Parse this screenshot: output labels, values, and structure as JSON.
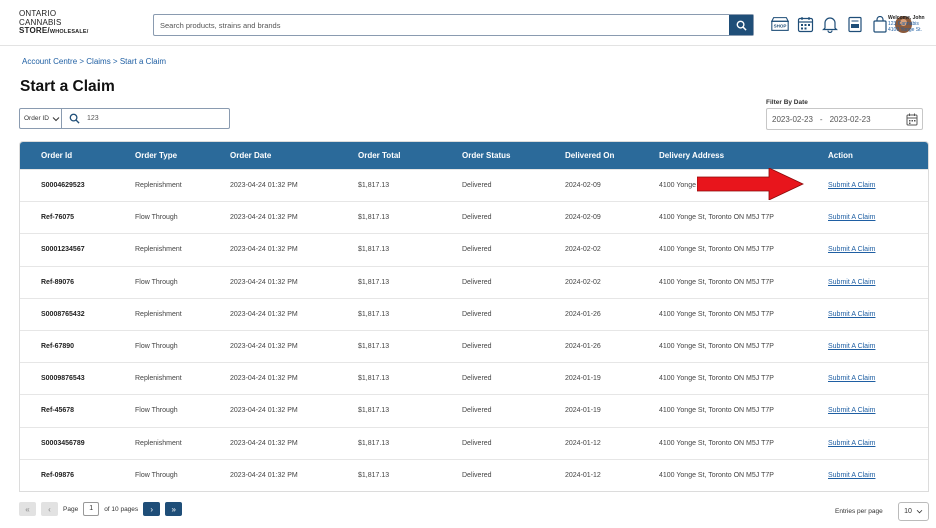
{
  "header": {
    "logo_line1": "ONTARIO",
    "logo_line2": "CANNABIS",
    "logo_line3": "STORE/",
    "logo_line3_small": "WHOLESALE/",
    "search_placeholder": "Search products, strains and brands",
    "welcome": "Welcome, John",
    "store_name": "123 Cannabis",
    "store_address": "4100 Yonge St.",
    "icons": [
      "shop-icon",
      "calendar-icon",
      "bell-icon",
      "invoice-icon",
      "shopping-bag-icon",
      "avatar"
    ]
  },
  "breadcrumb": "Account Centre > Claims > Start a Claim",
  "page_title": "Start a Claim",
  "filter": {
    "type_label": "Order ID",
    "value": "123",
    "date_label": "Filter By Date",
    "date_from": "2023-02-23",
    "date_to": "2023-02-23",
    "date_separator": "-"
  },
  "table": {
    "columns": [
      "Order Id",
      "Order Type",
      "Order Date",
      "Order Total",
      "Order Status",
      "Delivered On",
      "Delivery Address",
      "Action"
    ],
    "rows": [
      {
        "id": "S0004629523",
        "type": "Replenishment",
        "date": "2023-04-24 01:32 PM",
        "total": "$1,817.13",
        "status": "Delivered",
        "delivered": "2024-02-09",
        "address": "4100 Yonge",
        "action": "Submit A Claim"
      },
      {
        "id": "Ref-76075",
        "type": "Flow Through",
        "date": "2023-04-24 01:32 PM",
        "total": "$1,817.13",
        "status": "Delivered",
        "delivered": "2024-02-09",
        "address": "4100 Yonge St, Toronto ON M5J T7P",
        "action": "Submit A Claim"
      },
      {
        "id": "S0001234567",
        "type": "Replenishment",
        "date": "2023-04-24 01:32 PM",
        "total": "$1,817.13",
        "status": "Delivered",
        "delivered": "2024-02-02",
        "address": "4100 Yonge St, Toronto ON M5J T7P",
        "action": "Submit A Claim"
      },
      {
        "id": "Ref-89076",
        "type": "Flow Through",
        "date": "2023-04-24 01:32 PM",
        "total": "$1,817.13",
        "status": "Delivered",
        "delivered": "2024-02-02",
        "address": "4100 Yonge St, Toronto ON M5J T7P",
        "action": "Submit A Claim"
      },
      {
        "id": "S0008765432",
        "type": "Replenishment",
        "date": "2023-04-24 01:32 PM",
        "total": "$1,817.13",
        "status": "Delivered",
        "delivered": "2024-01-26",
        "address": "4100 Yonge St, Toronto ON M5J T7P",
        "action": "Submit A Claim"
      },
      {
        "id": "Ref-67890",
        "type": "Flow Through",
        "date": "2023-04-24 01:32 PM",
        "total": "$1,817.13",
        "status": "Delivered",
        "delivered": "2024-01-26",
        "address": "4100 Yonge St, Toronto ON M5J T7P",
        "action": "Submit A Claim"
      },
      {
        "id": "S0009876543",
        "type": "Replenishment",
        "date": "2023-04-24 01:32 PM",
        "total": "$1,817.13",
        "status": "Delivered",
        "delivered": "2024-01-19",
        "address": "4100 Yonge St, Toronto ON M5J T7P",
        "action": "Submit A Claim"
      },
      {
        "id": "Ref-45678",
        "type": "Flow Through",
        "date": "2023-04-24 01:32 PM",
        "total": "$1,817.13",
        "status": "Delivered",
        "delivered": "2024-01-19",
        "address": "4100 Yonge St, Toronto ON M5J T7P",
        "action": "Submit A Claim"
      },
      {
        "id": "S0003456789",
        "type": "Replenishment",
        "date": "2023-04-24 01:32 PM",
        "total": "$1,817.13",
        "status": "Delivered",
        "delivered": "2024-01-12",
        "address": "4100 Yonge St, Toronto ON M5J T7P",
        "action": "Submit A Claim"
      },
      {
        "id": "Ref-09876",
        "type": "Flow Through",
        "date": "2023-04-24 01:32 PM",
        "total": "$1,817.13",
        "status": "Delivered",
        "delivered": "2024-01-12",
        "address": "4100 Yonge St, Toronto ON M5J T7P",
        "action": "Submit A Claim"
      }
    ]
  },
  "pagination": {
    "page_label": "Page",
    "current_page": "1",
    "of_label": "of 10 pages",
    "entries_label": "Entries per page",
    "entries_value": "10"
  },
  "colors": {
    "header_blue": "#2b6a9a",
    "button_navy": "#1f4e78",
    "link_blue": "#1f5fa3",
    "arrow_red": "#e8151c"
  }
}
